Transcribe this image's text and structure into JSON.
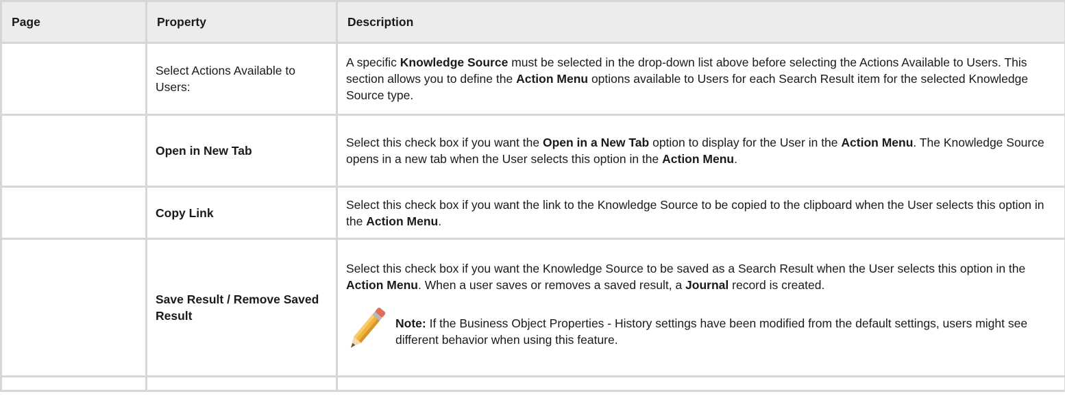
{
  "table": {
    "headers": {
      "page": "Page",
      "property": "Property",
      "description": "Description"
    },
    "rows": [
      {
        "page": "",
        "property": "Select Actions Available to Users:",
        "description": {
          "s1": "A specific ",
          "b1": "Knowledge Source",
          "s2": " must be selected in the drop-down list above before selecting the Actions Available to Users. This section allows you to define the ",
          "b2": "Action Menu",
          "s3": " options available to Users for each Search Result item for the selected Knowledge Source type."
        }
      },
      {
        "page": "",
        "property": "Open in New Tab",
        "description": {
          "s1": "Select this check box if you want the ",
          "b1": "Open in a New Tab",
          "s2": " option to display for the User in the ",
          "b2": "Action Menu",
          "s3": ". The Knowledge Source opens in a new tab when the User selects this option in the ",
          "b3": "Action Menu",
          "s4": "."
        }
      },
      {
        "page": "",
        "property": "Copy Link",
        "description": {
          "s1": "Select this check box if you want the link to the Knowledge Source to be copied to the clipboard when the User selects this option in the ",
          "b1": "Action Menu",
          "s2": "."
        }
      },
      {
        "page": "",
        "property": "Save Result / Remove Saved Result",
        "description": {
          "s1": "Select this check box if you want the Knowledge Source to be saved as a Search Result when the User selects this option in the ",
          "b1": "Action Menu",
          "s2": ". When a user saves or removes a saved result, a ",
          "b2": "Journal",
          "s3": " record is created."
        },
        "note": {
          "label": "Note:",
          "text": " If the Business Object Properties - History settings have been modified from the default settings, users might see different behavior when using this feature.",
          "icon": "pencil-icon"
        }
      }
    ]
  }
}
